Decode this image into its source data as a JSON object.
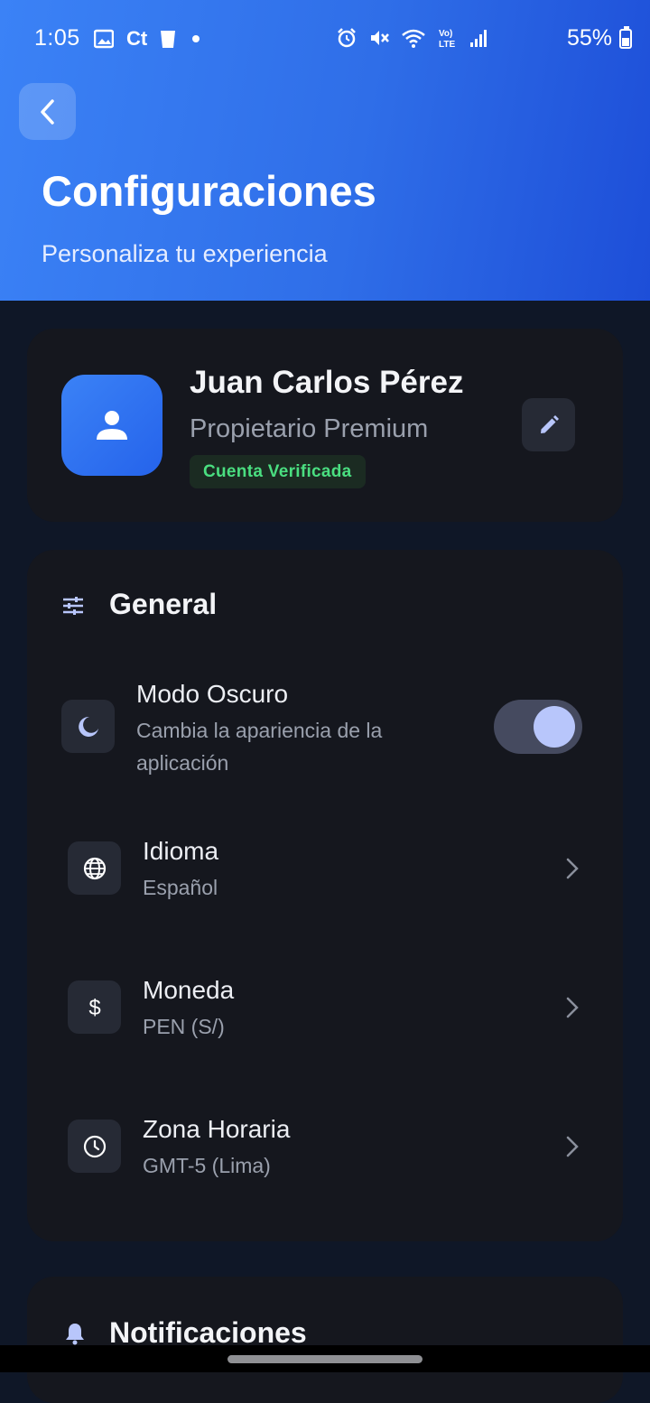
{
  "status_bar": {
    "time": "1:05",
    "ct_label": "Ct",
    "battery": "55%",
    "icons_left": [
      "image-icon",
      "ct-icon",
      "cup-icon",
      "dot-icon"
    ],
    "icons_right": [
      "alarm-icon",
      "mute-icon",
      "wifi-icon",
      "volte-icon",
      "signal-icon"
    ]
  },
  "header": {
    "title": "Configuraciones",
    "subtitle": "Personaliza tu experiencia",
    "back_icon": "chevron-left-icon"
  },
  "profile": {
    "name": "Juan Carlos Pérez",
    "role": "Propietario Premium",
    "badge": "Cuenta Verificada",
    "avatar_icon": "person-icon",
    "edit_icon": "pencil-icon"
  },
  "general": {
    "title": "General",
    "icon": "sliders-icon",
    "dark_mode": {
      "title": "Modo Oscuro",
      "subtitle_line1": "Cambia la apariencia de la",
      "subtitle_line2": "aplicación",
      "icon": "moon-icon",
      "enabled": true
    },
    "items": [
      {
        "title": "Idioma",
        "value": "Español",
        "icon": "globe-icon"
      },
      {
        "title": "Moneda",
        "value": "PEN (S/)",
        "icon": "dollar-icon"
      },
      {
        "title": "Zona Horaria",
        "value": "GMT-5 (Lima)",
        "icon": "clock-icon"
      }
    ]
  },
  "notifications": {
    "title": "Notificaciones",
    "icon": "bell-icon"
  },
  "colors": {
    "header_gradient_start": "#3b82f6",
    "header_gradient_end": "#1d4ed8",
    "background": "#0f1727",
    "card": "#15171e",
    "accent": "#b8c6fb",
    "verified_green": "#4ade80"
  }
}
